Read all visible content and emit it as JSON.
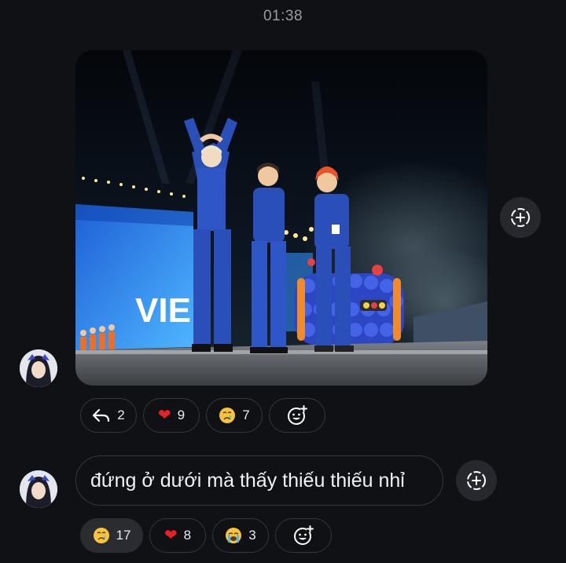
{
  "header": {
    "timestamp": "01:38"
  },
  "photo_message": {
    "sign_text": "VIE",
    "reactions": [
      {
        "icon": "reply-icon",
        "count": "2",
        "active": false
      },
      {
        "icon": "red-heart",
        "count": "9",
        "active": false
      },
      {
        "icon": "crying-face",
        "count": "7",
        "active": false
      },
      {
        "icon": "add-reaction-icon",
        "count": null,
        "active": false
      }
    ]
  },
  "text_message": {
    "text": "đứng ở dưới mà thấy thiếu thiếu nhỉ",
    "reactions": [
      {
        "icon": "crying-face",
        "count": "17",
        "active": true
      },
      {
        "icon": "red-heart",
        "count": "8",
        "active": false
      },
      {
        "icon": "loudly-crying-face",
        "count": "3",
        "active": false
      },
      {
        "icon": "add-reaction-icon",
        "count": null,
        "active": false
      }
    ]
  },
  "colors": {
    "background": "#0f1115",
    "pill_border": "#34363b",
    "action_button": "#26282d",
    "costume_blue": "#2a4fb8"
  }
}
